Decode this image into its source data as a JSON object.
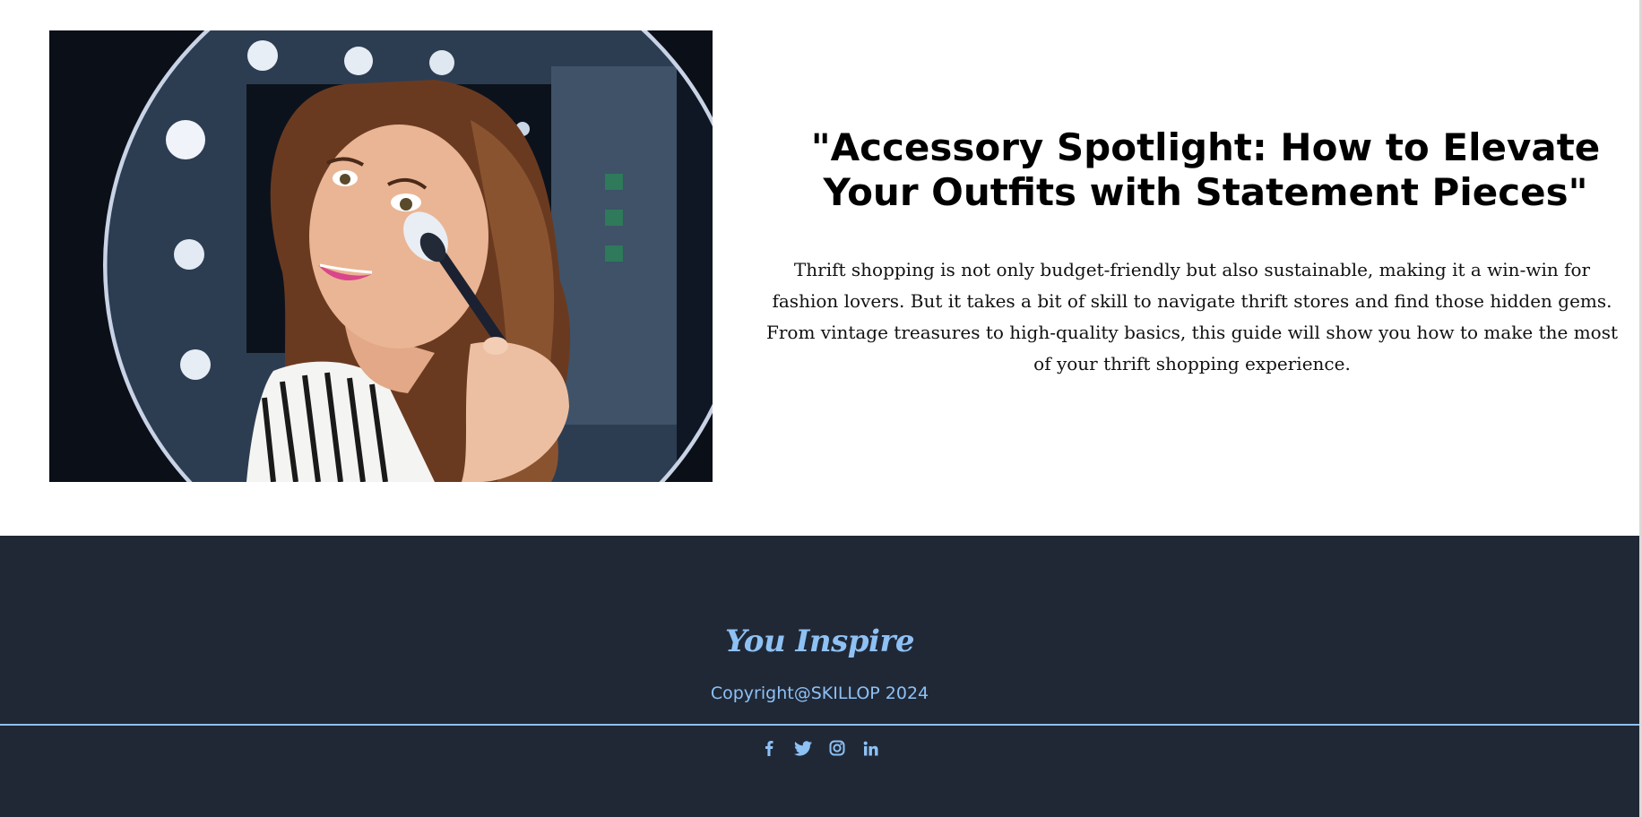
{
  "article": {
    "image_alt": "Woman applying makeup with a brush in a ring-light mirror",
    "headline": "\"Accessory Spotlight: How to Elevate Your Outfits with Statement Pieces\"",
    "intro": "Thrift shopping is not only budget-friendly but also sustainable, making it a win-win for fashion lovers. But it takes a bit of skill to navigate thrift stores and find those hidden gems. From vintage treasures to high-quality basics, this guide will show you how to make the most of your thrift shopping experience."
  },
  "footer": {
    "brand": "You Inspire",
    "copyright": "Copyright@SKILLOP 2024",
    "social_icons": [
      "facebook-icon",
      "twitter-icon",
      "instagram-icon",
      "linkedin-icon"
    ],
    "accent_color": "#8ec1f4",
    "background_color": "#202836"
  }
}
